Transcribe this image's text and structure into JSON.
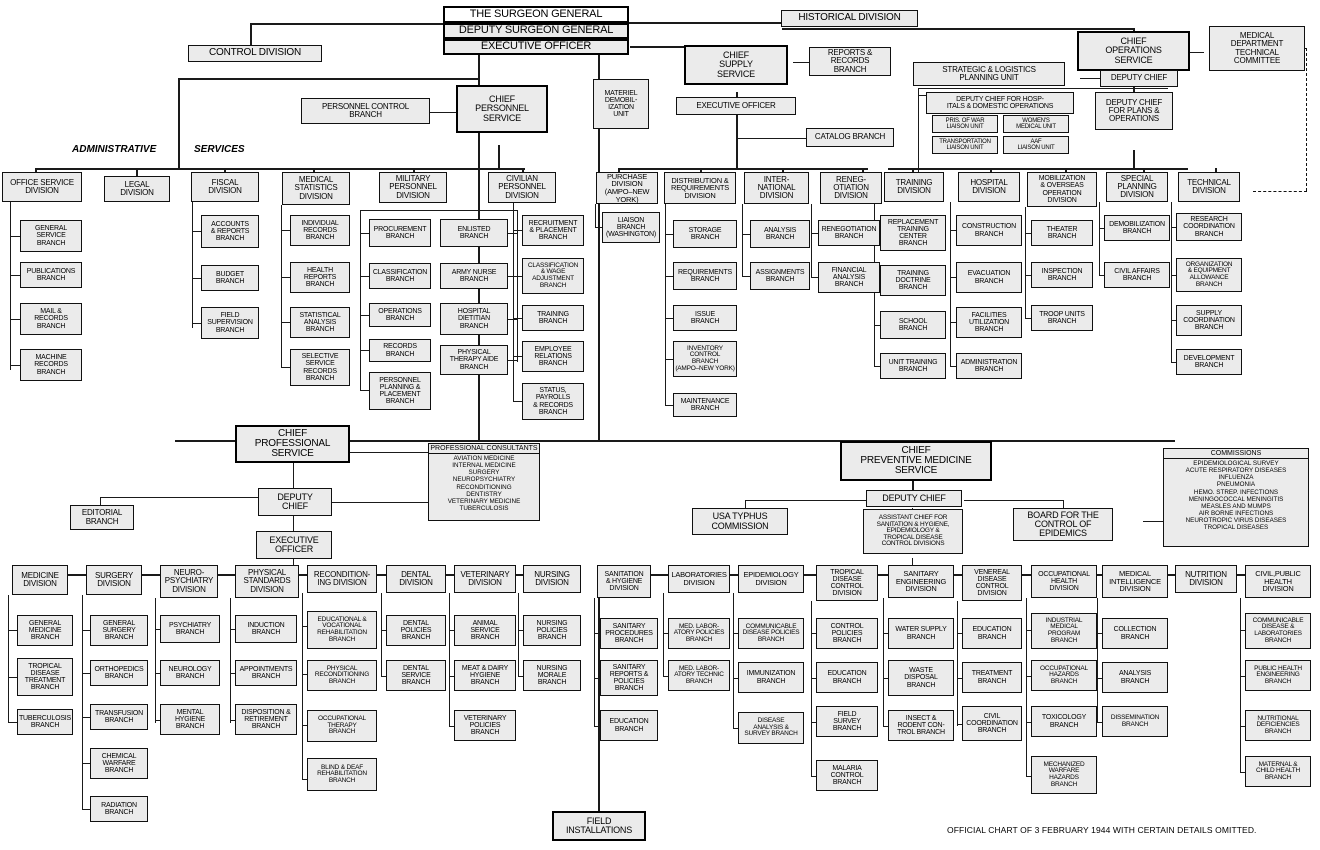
{
  "chart": {
    "footer_note": "OFFICIAL CHART OF 3 FEBRUARY 1944 WITH CERTAIN DETAILS OMITTED.",
    "section_labels": {
      "administrative": "ADMINISTRATIVE",
      "services": "SERVICES"
    }
  },
  "top": {
    "surgeon_general": "THE SURGEON GENERAL",
    "deputy_surgeon_general": "DEPUTY SURGEON GENERAL",
    "executive_officer": "EXECUTIVE  OFFICER",
    "historical_division": "HISTORICAL DIVISION",
    "control_division": "CONTROL DIVISION",
    "materiel_demobilization_unit": "MATERIEL\nDEMOBIL-\nIZATION\nUNIT",
    "medical_department_technical_committee": "MEDICAL\nDEPARTMENT\nTECHNICAL\nCOMMITTEE"
  },
  "personnel_service": {
    "head": "CHIEF\nPERSONNEL\nSERVICE",
    "personnel_control_branch": "PERSONNEL CONTROL\nBRANCH",
    "divisions": [
      {
        "name": "OFFICE SERVICE\nDIVISION",
        "branches": [
          "GENERAL\nSERVICE\nBRANCH",
          "PUBLICATIONS\nBRANCH",
          "MAIL &\nRECORDS\nBRANCH",
          "MACHINE\nRECORDS\nBRANCH"
        ]
      },
      {
        "name": "LEGAL\nDIVISION",
        "branches": []
      },
      {
        "name": "FISCAL\nDIVISION",
        "branches": [
          "ACCOUNTS\n& REPORTS\nBRANCH",
          "BUDGET\nBRANCH",
          "FIELD\nSUPERVISION\nBRANCH"
        ]
      },
      {
        "name": "MEDICAL\nSTATISTICS\nDIVISION",
        "branches": [
          "INDIVIDUAL\nRECORDS\nBRANCH",
          "HEALTH\nREPORTS\nBRANCH",
          "STATISTICAL\nANALYSIS\nBRANCH",
          "SELECTIVE\nSERVICE\nRECORDS\nBRANCH"
        ]
      },
      {
        "name": "MILITARY\nPERSONNEL\nDIVISION",
        "branches": [
          "PROCUREMENT\nBRANCH",
          "CLASSIFICATION\nBRANCH",
          "OPERATIONS\nBRANCH",
          "RECORDS\nBRANCH",
          "PERSONNEL\nPLANNING &\nPLACEMENT\nBRANCH"
        ],
        "branches2": [
          "ENLISTED\nBRANCH",
          "ARMY NURSE\nBRANCH",
          "HOSPITAL\nDIETITIAN\nBRANCH",
          "PHYSICAL\nTHERAPY AIDE\nBRANCH"
        ]
      },
      {
        "name": "CIVILIAN\nPERSONNEL\nDIVISION",
        "branches": [
          "RECRUITMENT\n& PLACEMENT\nBRANCH",
          "CLASSIFICATION\n& WAGE\nADJUSTMENT\nBRANCH",
          "TRAINING\nBRANCH",
          "EMPLOYEE\nRELATIONS\nBRANCH",
          "STATUS,\nPAYROLLS\n& RECORDS\nBRANCH"
        ]
      }
    ]
  },
  "supply_service": {
    "head": "CHIEF\nSUPPLY\nSERVICE",
    "executive_officer": "EXECUTIVE OFFICER",
    "reports_records_branch": "REPORTS &\nRECORDS\nBRANCH",
    "catalog_branch": "CATALOG BRANCH",
    "divisions": [
      {
        "name": "PURCHASE\nDIVISION\n(AMPO–NEW YORK)",
        "branches": [
          "LIAISON\nBRANCH\n(WASHINGTON)"
        ]
      },
      {
        "name": "DISTRIBUTION &\nREQUIREMENTS\nDIVISION",
        "branches": [
          "STORAGE\nBRANCH",
          "REQUIREMENTS\nBRANCH",
          "ISSUE\nBRANCH",
          "INVENTORY\nCONTROL\nBRANCH\n(AMPO–NEW YORK)",
          "MAINTENANCE\nBRANCH"
        ]
      },
      {
        "name": "INTER-\nNATIONAL\nDIVISION",
        "branches": [
          "ANALYSIS\nBRANCH",
          "ASSIGNMENTS\nBRANCH"
        ]
      },
      {
        "name": "RENEG-\nOTIATION\nDIVISION",
        "branches": [
          "RENEGOTIATION\nBRANCH",
          "FINANCIAL\nANALYSIS\nBRANCH"
        ]
      }
    ]
  },
  "operations_service": {
    "head": "CHIEF\nOPERATIONS\nSERVICE",
    "deputy_chief": "DEPUTY CHIEF",
    "strategic_logistics_planning_unit": "STRATEGIC & LOGISTICS\nPLANNING UNIT",
    "deputy_chief_hospitals": "DEPUTY CHIEF FOR HOSP-\nITALS & DOMESTIC OPERATIONS",
    "deputy_chief_plans": "DEPUTY CHIEF\nFOR PLANS &\nOPERATIONS",
    "units": [
      "PRIS. OF WAR\nLIAISON UNIT",
      "WOMEN'S\nMEDICAL UNIT",
      "TRANSPORTATION\nLIAISON UNIT",
      "AAF\nLIAISON UNIT"
    ],
    "divisions": [
      {
        "name": "TRAINING\nDIVISION",
        "branches": [
          "REPLACEMENT\nTRAINING\nCENTER\nBRANCH",
          "TRAINING\nDOCTRINE\nBRANCH",
          "SCHOOL\nBRANCH",
          "UNIT TRAINING\nBRANCH"
        ]
      },
      {
        "name": "HOSPITAL\nDIVISION",
        "branches": [
          "CONSTRUCTION\nBRANCH",
          "EVACUATION\nBRANCH",
          "FACILITIES\nUTILIZATION\nBRANCH",
          "ADMINISTRATION\nBRANCH"
        ]
      },
      {
        "name": "MOBILIZATION\n& OVERSEAS\nOPERATION\nDIVISION",
        "branches": [
          "THEATER\nBRANCH",
          "INSPECTION\nBRANCH",
          "TROOP UNITS\nBRANCH"
        ]
      },
      {
        "name": "SPECIAL\nPLANNING\nDIVISION",
        "branches": [
          "DEMOBILIZATION\nBRANCH",
          "CIVIL AFFAIRS\nBRANCH"
        ]
      },
      {
        "name": "TECHNICAL\nDIVISION",
        "branches": [
          "RESEARCH\nCOORDINATION\nBRANCH",
          "ORGANIZATION\n& EQUIPMENT\nALLOWANCE\nBRANCH",
          "SUPPLY\nCOORDINATION\nBRANCH",
          "DEVELOPMENT\nBRANCH"
        ]
      }
    ]
  },
  "professional_service": {
    "head": "CHIEF\nPROFESSIONAL\nSERVICE",
    "deputy_chief": "DEPUTY\nCHIEF",
    "executive_officer": "EXECUTIVE\nOFFICER",
    "editorial_branch": "EDITORIAL\nBRANCH",
    "consultants_title": "PROFESSIONAL\nCONSULTANTS",
    "consultants_list": "AVIATION MEDICINE\nINTERNAL MEDICINE\nSURGERY\nNEUROPSYCHIATRY\nRECONDITIONING\nDENTISTRY\nVETERINARY MEDICINE\nTUBERCULOSIS",
    "divisions": [
      {
        "name": "MEDICINE\nDIVISION",
        "branches": [
          "GENERAL\nMEDICINE\nBRANCH",
          "TROPICAL\nDISEASE\nTREATMENT\nBRANCH",
          "TUBERCULOSIS\nBRANCH"
        ]
      },
      {
        "name": "SURGERY\nDIVISION",
        "branches": [
          "GENERAL\nSURGERY\nBRANCH",
          "ORTHOPEDICS\nBRANCH",
          "TRANSFUSION\nBRANCH",
          "CHEMICAL\nWARFARE\nBRANCH",
          "RADIATION\nBRANCH"
        ]
      },
      {
        "name": "NEURO-\nPSYCHIATRY\nDIVISION",
        "branches": [
          "PSYCHIATRY\nBRANCH",
          "NEUROLOGY\nBRANCH",
          "MENTAL\nHYGIENE\nBRANCH"
        ]
      },
      {
        "name": "PHYSICAL\nSTANDARDS\nDIVISION",
        "branches": [
          "INDUCTION\nBRANCH",
          "APPOINTMENTS\nBRANCH",
          "DISPOSITION &\nRETIREMENT\nBRANCH"
        ]
      },
      {
        "name": "RECONDITION-\nING DIVISION",
        "branches": [
          "EDUCATIONAL &\nVOCATIONAL\nREHABILITATION\nBRANCH",
          "PHYSICAL\nRECONDITIONING\nBRANCH",
          "OCCUPATIONAL\nTHERAPY\nBRANCH",
          "BLIND & DEAF\nREHABILITATION\nBRANCH"
        ]
      },
      {
        "name": "DENTAL\nDIVISION",
        "branches": [
          "DENTAL\nPOLICIES\nBRANCH",
          "DENTAL\nSERVICE\nBRANCH"
        ]
      },
      {
        "name": "VETERINARY\nDIVISION",
        "branches": [
          "ANIMAL\nSERVICE\nBRANCH",
          "MEAT & DAIRY\nHYGIENE\nBRANCH",
          "VETERINARY\nPOLICIES\nBRANCH"
        ]
      },
      {
        "name": "NURSING\nDIVISION",
        "branches": [
          "NURSING\nPOLICIES\nBRANCH",
          "NURSING\nMORALE\nBRANCH"
        ]
      }
    ]
  },
  "preventive_medicine_service": {
    "head": "CHIEF\nPREVENTIVE MEDICINE\nSERVICE",
    "deputy_chief": "DEPUTY CHIEF",
    "usa_typhus_commission": "USA  TYPHUS\nCOMMISSION",
    "assistant_chief": "ASSISTANT CHIEF FOR\nSANITATION & HYGIENE,\nEPIDEMIOLOGY &\nTROPICAL DISEASE\nCONTROL  DIVISIONS",
    "board_control_epidemics": "BOARD FOR THE\nCONTROL OF\nEPIDEMICS",
    "commissions_title": "COMMISSIONS",
    "commissions_list": "EPIDEMIOLOGICAL SURVEY\nACUTE RESPIRATORY DISEASES\nINFLUENZA\nPNEUMONIA\nHEMO. STREP. INFECTIONS\nMENINGOCOCCAL MENINGITIS\nMEASLES AND MUMPS\nAIR BORNE INFECTIONS\nNEUROTROPIC VIRUS DISEASES\nTROPICAL DISEASES",
    "divisions": [
      {
        "name": "SANITATION\n&  HYGIENE\nDIVISION",
        "branches": [
          "SANITARY\nPROCEDURES\nBRANCH",
          "SANITARY\nREPORTS &\nPOLICIES\nBRANCH",
          "EDUCATION\nBRANCH"
        ]
      },
      {
        "name": "LABORATORIES\nDIVISION",
        "branches": [
          "MED. LABOR-\nATORY POLICIES\nBRANCH",
          "MED. LABOR-\nATORY TECHNIC\nBRANCH"
        ]
      },
      {
        "name": "EPIDEMIOLOGY\nDIVISION",
        "branches": [
          "COMMUNICABLE\nDISEASE POLICIES\nBRANCH",
          "IMMUNIZATION\nBRANCH",
          "DISEASE\nANALYSIS &\nSURVEY BRANCH"
        ]
      },
      {
        "name": "TROPICAL\nDISEASE\nCONTROL\nDIVISION",
        "branches": [
          "CONTROL\nPOLICIES\nBRANCH",
          "EDUCATION\nBRANCH",
          "FIELD\nSURVEY\nBRANCH",
          "MALARIA\nCONTROL\nBRANCH"
        ]
      },
      {
        "name": "SANITARY\nENGINEERING\nDIVISION",
        "branches": [
          "WATER SUPPLY\nBRANCH",
          "WASTE\nDISPOSAL\nBRANCH",
          "INSECT &\nRODENT CON-\nTROL BRANCH"
        ]
      },
      {
        "name": "VENEREAL\nDISEASE\nCONTROL\nDIVISION",
        "branches": [
          "EDUCATION\nBRANCH",
          "TREATMENT\nBRANCH",
          "CIVIL\nCOORDINATION\nBRANCH"
        ]
      },
      {
        "name": "OCCUPATIONAL\nHEALTH\nDIVISION",
        "branches": [
          "INDUSTRIAL\nMEDICAL\nPROGRAM\nBRANCH",
          "OCCUPATIONAL\nHAZARDS\nBRANCH",
          "TOXICOLOGY\nBRANCH",
          "MECHANIZED\nWARFARE\nHAZARDS\nBRANCH"
        ]
      },
      {
        "name": "MEDICAL\nINTELLIGENCE\nDIVISION",
        "branches": [
          "COLLECTION\nBRANCH",
          "ANALYSIS\nBRANCH",
          "DISSEMINATION\nBRANCH"
        ]
      },
      {
        "name": "NUTRITION\nDIVISION",
        "branches": []
      },
      {
        "name": "CIVIL,PUBLIC\nHEALTH\nDIVISION",
        "branches": [
          "COMMUNICABLE\nDISEASE &\nLABORATORIES\nBRANCH",
          "PUBLIC HEALTH\nENGINEERING\nBRANCH",
          "NUTRITIONAL\nDEFICIENCIES\nBRANCH",
          "MATERNAL &\nCHILD HEALTH\nBRANCH"
        ]
      }
    ]
  },
  "bottom": {
    "field_installations": "FIELD\nINSTALLATIONS"
  }
}
